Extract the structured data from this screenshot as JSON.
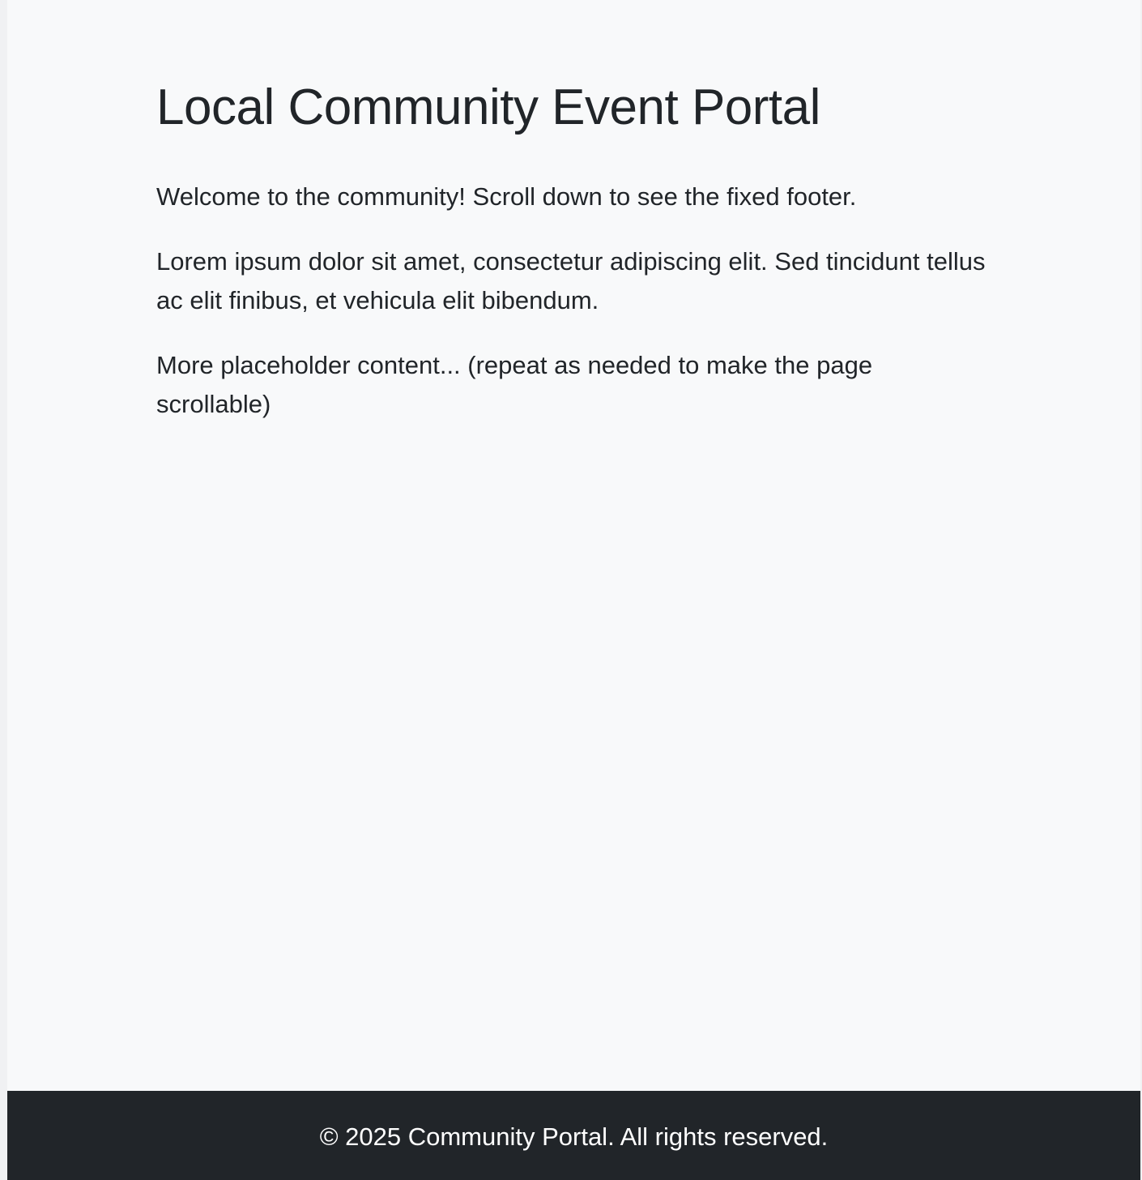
{
  "header": {
    "title": "Local Community Event Portal"
  },
  "main": {
    "paragraphs": [
      "Welcome to the community! Scroll down to see the fixed footer.",
      "Lorem ipsum dolor sit amet, consectetur adipiscing elit. Sed tincidunt tellus ac elit finibus, et vehicula elit bibendum.",
      "More placeholder content... (repeat as needed to make the page scrollable)"
    ]
  },
  "footer": {
    "text": "© 2025 Community Portal. All rights reserved."
  },
  "colors": {
    "page_background": "#f8f9fa",
    "text": "#212529",
    "footer_background": "#212529",
    "footer_text": "#ffffff"
  }
}
